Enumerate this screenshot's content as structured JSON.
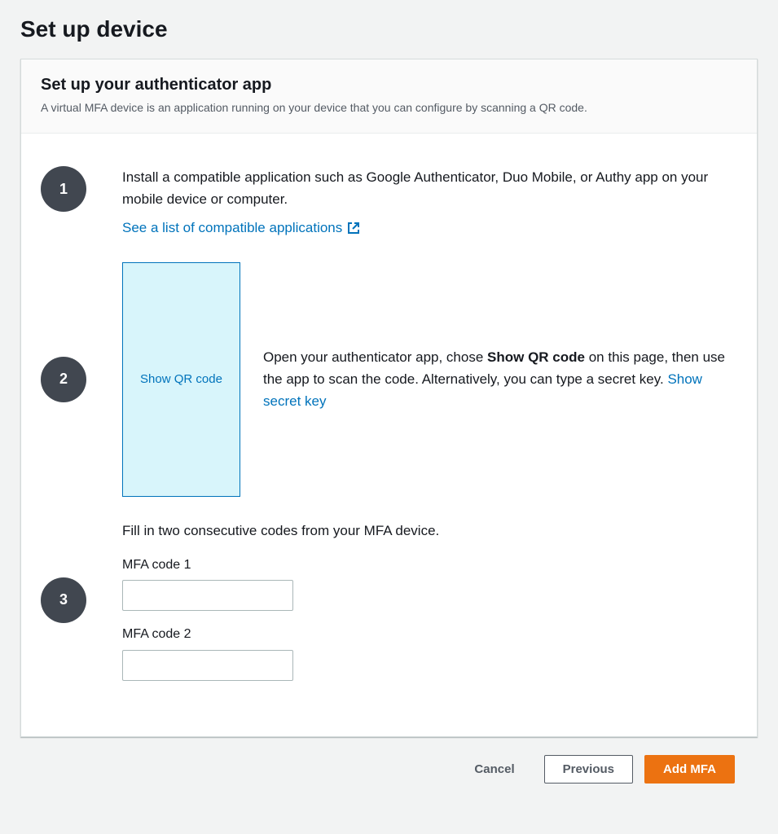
{
  "page": {
    "title": "Set up device"
  },
  "header": {
    "title": "Set up your authenticator app",
    "subtitle": "A virtual MFA device is an application running on your device that you can configure by scanning a QR code."
  },
  "steps": {
    "one": {
      "number": "1",
      "text": "Install a compatible application such as Google Authenticator, Duo Mobile, or Authy app on your mobile device or computer.",
      "link": "See a list of compatible applications"
    },
    "two": {
      "number": "2",
      "qr_button": "Show QR code",
      "text_before": "Open your authenticator app, chose ",
      "text_bold": "Show QR code",
      "text_after": " on this page, then use the app to scan the code. Alternatively, you can type a secret key. ",
      "secret_link": "Show secret key"
    },
    "three": {
      "number": "3",
      "intro": "Fill in two consecutive codes from your MFA device.",
      "code1_label": "MFA code 1",
      "code2_label": "MFA code 2",
      "code1_value": "",
      "code2_value": ""
    }
  },
  "buttons": {
    "cancel": "Cancel",
    "previous": "Previous",
    "add_mfa": "Add MFA"
  }
}
